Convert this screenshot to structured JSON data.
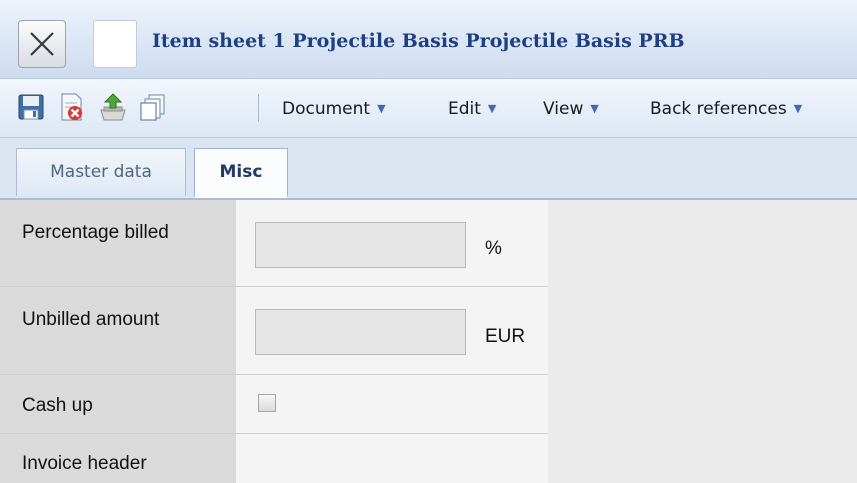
{
  "window": {
    "title": "Item sheet 1 Projectile Basis Projectile Basis PRB",
    "close_icon": "close-x-icon"
  },
  "toolbar": {
    "icons": [
      "save-icon",
      "discard-icon",
      "export-icon",
      "copy-icon"
    ],
    "menus": [
      {
        "label": "Document"
      },
      {
        "label": "Edit"
      },
      {
        "label": "View"
      },
      {
        "label": "Back references"
      }
    ]
  },
  "tabs": [
    {
      "label": "Master data",
      "active": false
    },
    {
      "label": "Misc",
      "active": true
    }
  ],
  "form": {
    "percentage_billed": {
      "label": "Percentage billed",
      "value": "",
      "unit": "%"
    },
    "unbilled_amount": {
      "label": "Unbilled amount",
      "value": "",
      "unit": "EUR"
    },
    "cash_up": {
      "label": "Cash up",
      "checked": false
    },
    "invoice_header": {
      "label": "Invoice header"
    }
  },
  "colors": {
    "title_text": "#1e3f82",
    "menu_arrow": "#3b6cb4",
    "label_cell": "#dadada",
    "workspace": "#ebebeb"
  }
}
